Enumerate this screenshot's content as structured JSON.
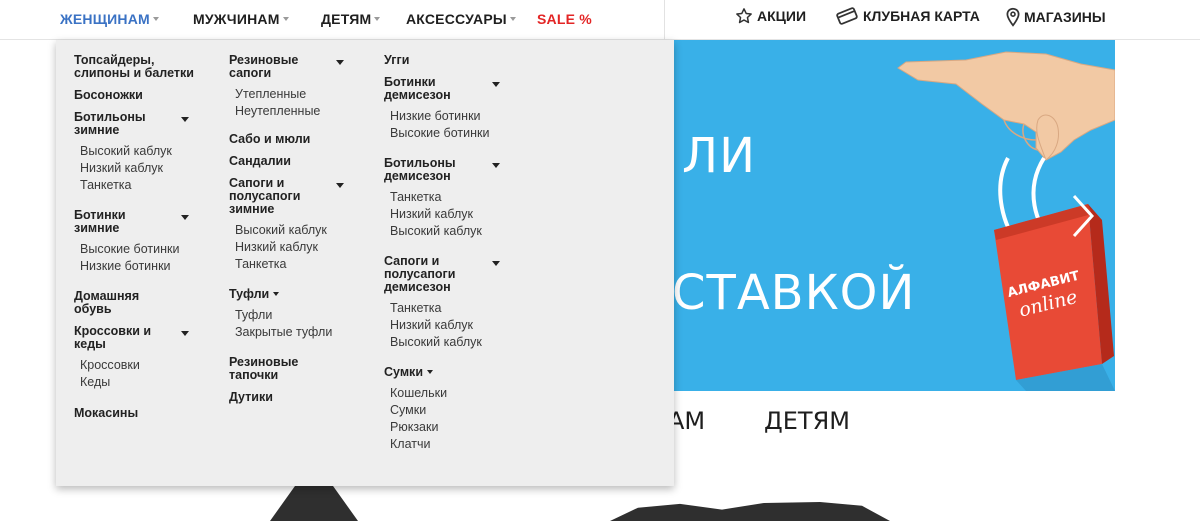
{
  "nav": {
    "women": "ЖЕНЩИНАМ",
    "men": "МУЖЧИНАМ",
    "kids": "ДЕТЯМ",
    "accessories": "АКСЕССУАРЫ",
    "sale": "SALE %",
    "promotions": "АКЦИИ",
    "club_card": "КЛУБНАЯ КАРТА",
    "stores": "МАГАЗИНЫ"
  },
  "colors": {
    "accent": "#3a72c4",
    "sale": "#e32525",
    "banner_bg": "#39b0e8",
    "bag": "#e84a36"
  },
  "banner": {
    "text_line1": "ЛИ",
    "text_line2": "СТАВКОЙ",
    "bag_logo_line1": "АЛФАВИТ",
    "bag_logo_line2": "online",
    "next_arrow_icon": "chevron-right-icon"
  },
  "below": {
    "men_partial": "АМ",
    "kids": "ДЕТЯМ"
  },
  "menu": {
    "col1": {
      "topsiders": "Топсайдеры, слипоны и балетки",
      "barefoot": "Босоножки",
      "ankle_winter": "Ботильоны зимние",
      "ankle_winter_items": [
        "Высокий каблук",
        "Низкий каблук",
        "Танкетка"
      ],
      "boots_winter": "Ботинки зимние",
      "boots_winter_items": [
        "Высокие ботинки",
        "Низкие ботинки"
      ],
      "home": "Домашняя обувь",
      "sneakers": "Кроссовки и кеды",
      "sneakers_items": [
        "Кроссовки",
        "Кеды"
      ],
      "moccasins": "Мокасины"
    },
    "col2": {
      "rubber_boots": "Резиновые сапоги",
      "rubber_boots_items": [
        "Утепленные",
        "Неутепленные"
      ],
      "clogs": "Сабо и мюли",
      "sandals": "Сандалии",
      "boots_winter": "Сапоги и полусапоги зимние",
      "boots_winter_items": [
        "Высокий каблук",
        "Низкий каблук",
        "Танкетка"
      ],
      "shoes": "Туфли",
      "shoes_items": [
        "Туфли",
        "Закрытые туфли"
      ],
      "rubber_slippers": "Резиновые тапочки",
      "dutiki": "Дутики"
    },
    "col3": {
      "uggs": "Угги",
      "boots_demi": "Ботинки демисезон",
      "boots_demi_items": [
        "Низкие ботинки",
        "Высокие ботинки"
      ],
      "ankle_demi": "Ботильоны демисезон",
      "ankle_demi_items": [
        "Танкетка",
        "Низкий каблук",
        "Высокий каблук"
      ],
      "boots_half_demi": "Сапоги и полусапоги демисезон",
      "boots_half_demi_items": [
        "Танкетка",
        "Низкий каблук",
        "Высокий каблук"
      ],
      "bags": "Сумки",
      "bags_items": [
        "Кошельки",
        "Сумки",
        "Рюкзаки",
        "Клатчи"
      ]
    }
  }
}
